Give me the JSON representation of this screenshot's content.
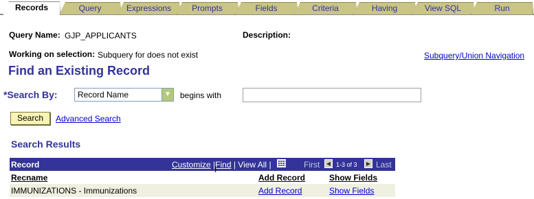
{
  "tabs": [
    {
      "label": "Records",
      "active": true
    },
    {
      "label": "Query",
      "active": false
    },
    {
      "label": "Expressions",
      "active": false
    },
    {
      "label": "Prompts",
      "active": false
    },
    {
      "label": "Fields",
      "active": false
    },
    {
      "label": "Criteria",
      "active": false
    },
    {
      "label": "Having",
      "active": false
    },
    {
      "label": "View SQL",
      "active": false
    },
    {
      "label": "Run",
      "active": false
    }
  ],
  "query": {
    "name_label": "Query Name:",
    "name_value": "GJP_APPLICANTS",
    "description_label": "Description:",
    "selection_label": "Working on selection:",
    "selection_value": "Subquery for does not exist",
    "nav_link": "Subquery/Union Navigation"
  },
  "find": {
    "title": "Find an Existing Record",
    "search_by_label": "*Search By:",
    "search_by_value": "Record Name",
    "operator_label": "begins with",
    "search_value": "",
    "search_button": "Search",
    "advanced_link": "Advanced Search"
  },
  "results": {
    "title": "Search Results",
    "grid_title": "Record",
    "customize": "Customize",
    "find": "Find",
    "view_all": "View All",
    "sep": "|",
    "first": "First",
    "count": "1-3 of 3",
    "last": "Last",
    "columns": [
      "Recname",
      "Add Record",
      "Show Fields"
    ],
    "rows": [
      {
        "recname": "IMMUNIZATIONS - Immunizations",
        "add": "Add Record",
        "show": "Show Fields"
      }
    ]
  },
  "colors": {
    "accent": "#333399",
    "tab": "#c9c586",
    "link": "#0000cc"
  }
}
